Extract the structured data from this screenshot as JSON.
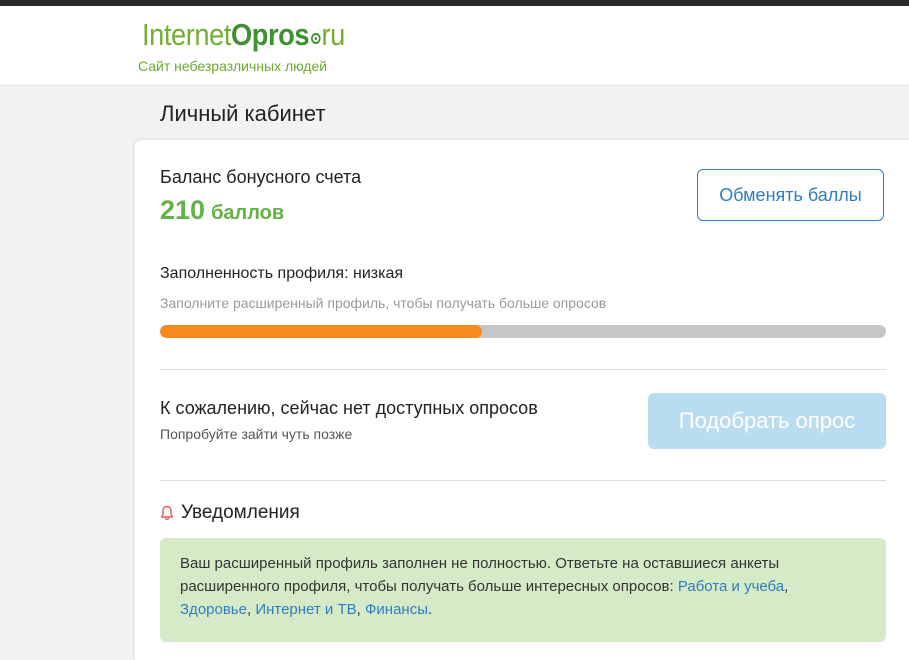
{
  "header": {
    "logo_part1": "Internet",
    "logo_part2": "Opros",
    "logo_part3": "ru",
    "tagline": "Сайт небезразличных людей"
  },
  "page": {
    "title": "Личный кабинет"
  },
  "balance": {
    "label": "Баланс бонусного счета",
    "amount": "210",
    "unit": "баллов",
    "exchange_button": "Обменять баллы"
  },
  "profile": {
    "fill_label": "Заполненность профиля: низкая",
    "fill_hint": "Заполните расширенный профиль, чтобы получать больше опросов",
    "fill_fraction": 0.443
  },
  "surveys": {
    "title": "К сожалению, сейчас нет доступных опросов",
    "hint": "Попробуйте зайти чуть позже",
    "pick_button": "Подобрать опрос"
  },
  "notifications": {
    "title": "Уведомления",
    "message_text": "Ваш расширенный профиль заполнен не полностью. Ответьте на оставшиеся анкеты расширенного профиля, чтобы получать больше интересных опросов: ",
    "links": [
      "Работа и учеба",
      "Здоровье",
      "Интернет и ТВ",
      "Финансы"
    ],
    "sep1": ",",
    "sep2": ", ",
    "sep3": ", ",
    "end": "."
  },
  "colors": {
    "accent_green": "#62b245",
    "progress_orange": "#f78a1d",
    "link_blue": "#2f7dbf",
    "notice_bg": "#d5ebc8",
    "disabled_button": "#b9dcf0"
  },
  "icons": {
    "notification": "bell-icon"
  }
}
